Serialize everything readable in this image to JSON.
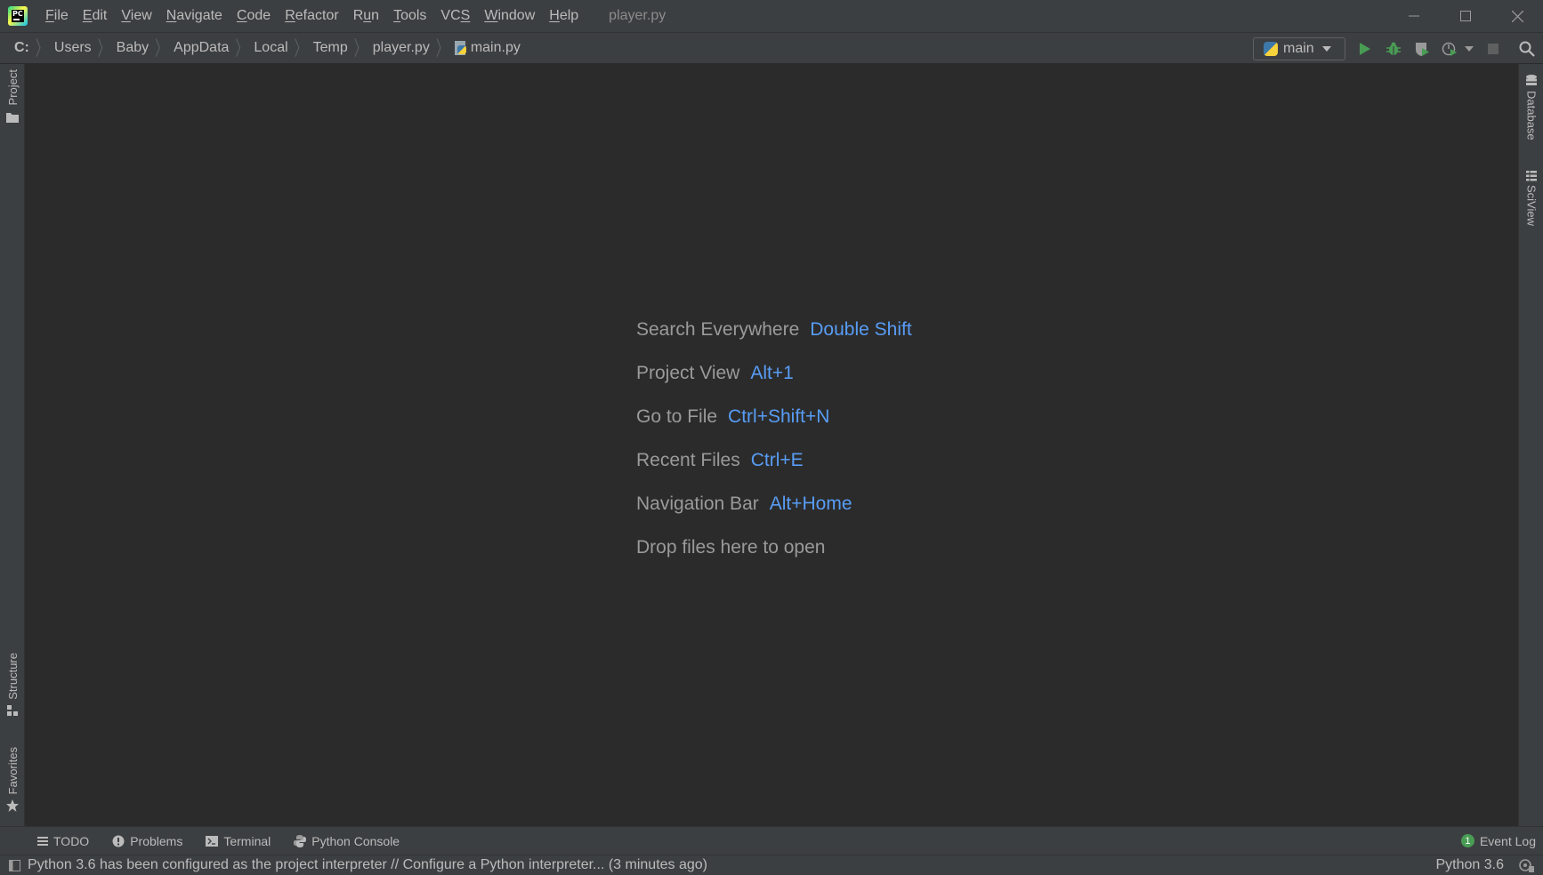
{
  "menu": {
    "items": [
      {
        "id": "file",
        "prefix": "",
        "mnemonic": "F",
        "rest": "ile"
      },
      {
        "id": "edit",
        "prefix": "",
        "mnemonic": "E",
        "rest": "dit"
      },
      {
        "id": "view",
        "prefix": "",
        "mnemonic": "V",
        "rest": "iew"
      },
      {
        "id": "navigate",
        "prefix": "",
        "mnemonic": "N",
        "rest": "avigate"
      },
      {
        "id": "code",
        "prefix": "",
        "mnemonic": "C",
        "rest": "ode"
      },
      {
        "id": "refactor",
        "prefix": "",
        "mnemonic": "R",
        "rest": "efactor"
      },
      {
        "id": "run",
        "prefix": "R",
        "mnemonic": "u",
        "rest": "n"
      },
      {
        "id": "tools",
        "prefix": "",
        "mnemonic": "T",
        "rest": "ools"
      },
      {
        "id": "vcs",
        "prefix": "VC",
        "mnemonic": "S",
        "rest": ""
      },
      {
        "id": "window",
        "prefix": "",
        "mnemonic": "W",
        "rest": "indow"
      },
      {
        "id": "help",
        "prefix": "",
        "mnemonic": "H",
        "rest": "elp"
      }
    ],
    "window_title": "player.py"
  },
  "breadcrumb": [
    "C:",
    "Users",
    "Baby",
    "AppData",
    "Local",
    "Temp",
    "player.py",
    "main.py"
  ],
  "run_config": {
    "label": "main"
  },
  "left_tabs": {
    "project": "Project",
    "structure": "Structure",
    "favorites": "Favorites"
  },
  "right_tabs": {
    "database": "Database",
    "sciview": "SciView"
  },
  "hints": [
    {
      "label": "Search Everywhere",
      "key": "Double Shift"
    },
    {
      "label": "Project View",
      "key": "Alt+1"
    },
    {
      "label": "Go to File",
      "key": "Ctrl+Shift+N"
    },
    {
      "label": "Recent Files",
      "key": "Ctrl+E"
    },
    {
      "label": "Navigation Bar",
      "key": "Alt+Home"
    },
    {
      "label": "Drop files here to open",
      "key": ""
    }
  ],
  "bottom_tools": {
    "todo": "TODO",
    "problems": "Problems",
    "terminal": "Terminal",
    "python_console": "Python Console",
    "event_log": "Event Log",
    "event_count": "1"
  },
  "status": {
    "message": "Python 3.6 has been configured as the project interpreter // Configure a Python interpreter... (3 minutes ago)",
    "interpreter": "Python 3.6"
  },
  "colors": {
    "accent_blue": "#589df6",
    "run_green": "#499c54",
    "bg": "#2b2b2b",
    "panel": "#3c3f41"
  }
}
